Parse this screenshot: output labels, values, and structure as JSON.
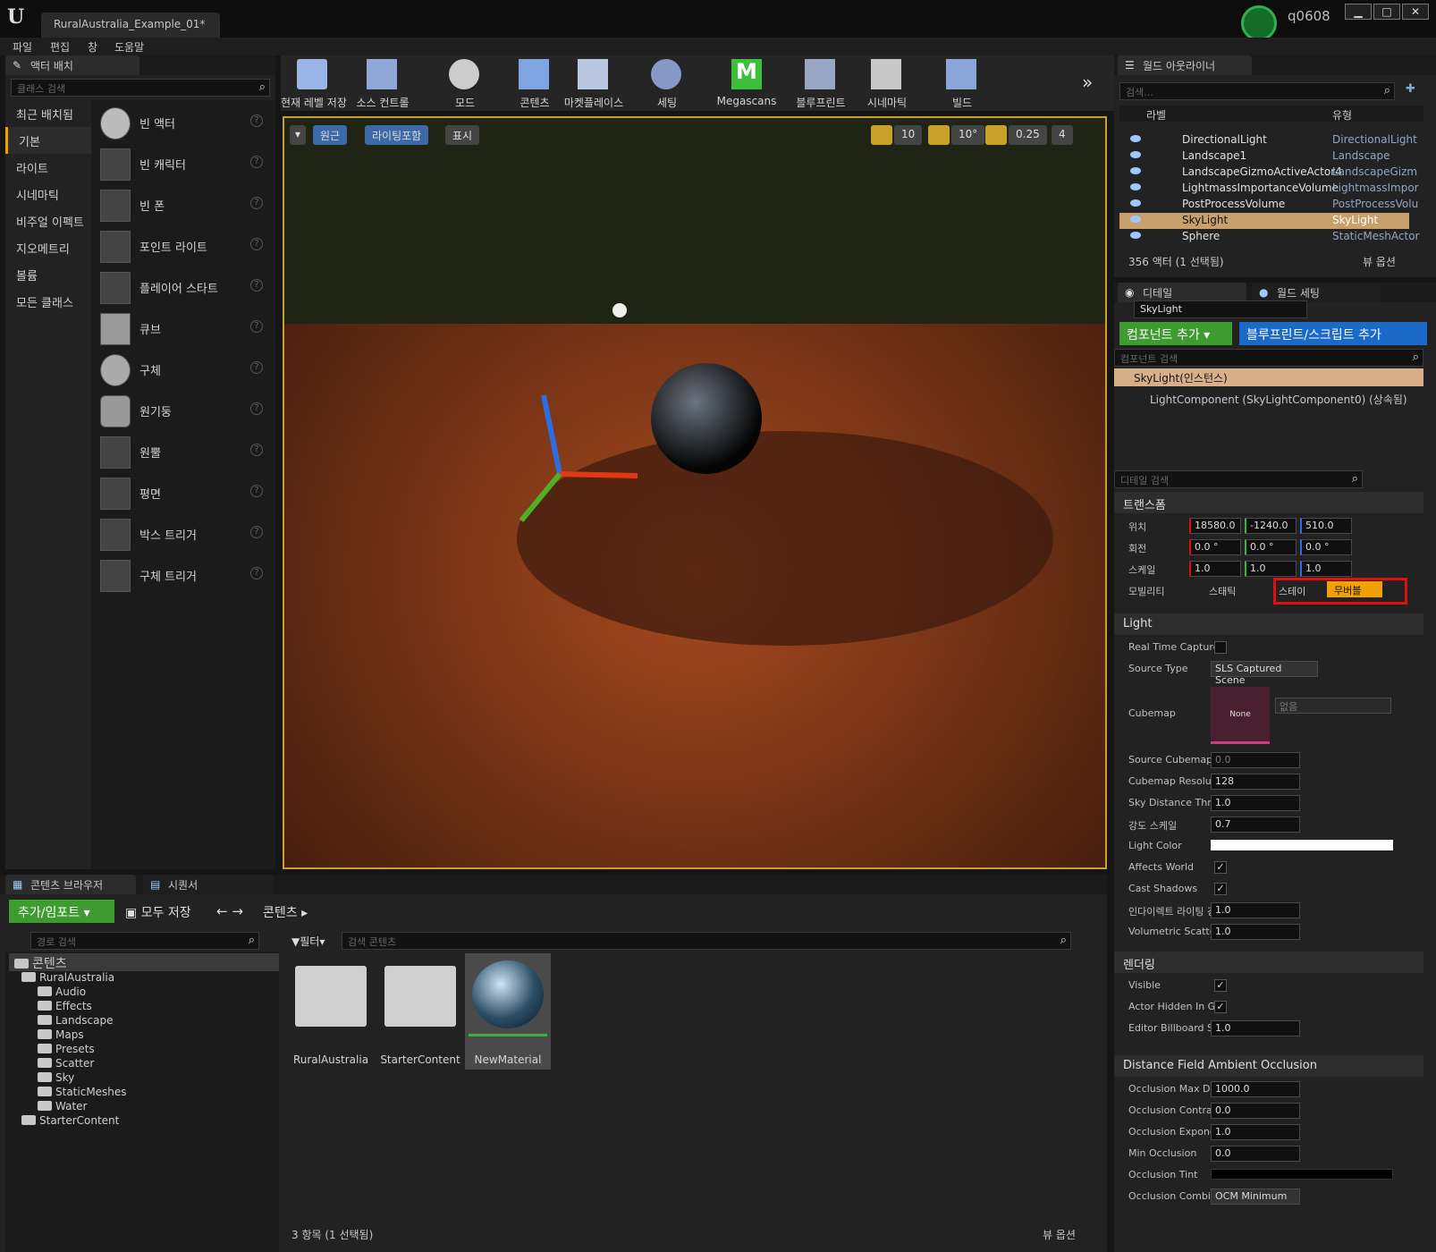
{
  "window": {
    "tab_title": "RuralAustralia_Example_01*",
    "user": "q0608",
    "minimize": "▁",
    "maximize": "□",
    "close": "✕"
  },
  "menu": [
    "파일",
    "편집",
    "창",
    "도움말"
  ],
  "place_panel": {
    "tab": "액터 배치",
    "search_placeholder": "클래스 검색",
    "categories": [
      "최근 배치됨",
      "기본",
      "라이트",
      "시네마틱",
      "비주얼 이펙트",
      "지오메트리",
      "볼륨",
      "모든 클래스"
    ],
    "items": [
      "빈 액터",
      "빈 캐릭터",
      "빈 폰",
      "포인트 라이트",
      "플레이어 스타트",
      "큐브",
      "구체",
      "원기둥",
      "원뿔",
      "평면",
      "박스 트리거",
      "구체 트리거"
    ]
  },
  "toolbar": [
    "현재 레벨 저장",
    "소스 컨트롤",
    "모드",
    "콘텐츠",
    "마켓플레이스",
    "세팅",
    "Megascans",
    "블루프린트",
    "시네마틱",
    "빌드"
  ],
  "viewport": {
    "perspective": "원근",
    "lighting": "라이팅포함",
    "show": "표시",
    "grid": "10",
    "rot": "10°",
    "scale": "0.25",
    "cam": "4"
  },
  "outliner": {
    "tab": "월드 아웃라이너",
    "search_placeholder": "검색...",
    "col_label": "라벨",
    "col_type": "유형",
    "rows": [
      {
        "label": "DirectionalLight",
        "type": "DirectionalLight"
      },
      {
        "label": "Landscape1",
        "type": "Landscape"
      },
      {
        "label": "LandscapeGizmoActiveActor4",
        "type": "LandscapeGizm"
      },
      {
        "label": "LightmassImportanceVolume",
        "type": "LightmassImpor"
      },
      {
        "label": "PostProcessVolume",
        "type": "PostProcessVolu"
      },
      {
        "label": "SkyLight",
        "type": "SkyLight"
      },
      {
        "label": "Sphere",
        "type": "StaticMeshActor"
      }
    ],
    "footer": "356 액터 (1 선택됨)",
    "view_options": "뷰 옵션"
  },
  "details": {
    "tab": "디테일",
    "tab2": "월드 세팅",
    "name": "SkyLight",
    "add_component": "컴포넌트 추가",
    "blueprint": "블루프린트/스크립트 추가",
    "comp_search": "컴포넌트 검색",
    "instance": "SkyLight(인스턴스)",
    "component": "LightComponent (SkyLightComponent0) (상속됨)",
    "detail_search": "디테일 검색",
    "transform": {
      "section": "트랜스폼",
      "location_label": "위치",
      "rotation_label": "회전",
      "scale_label": "스케일",
      "mobility_label": "모빌리티",
      "location": [
        "18580.0",
        "-1240.0",
        "510.0"
      ],
      "rotation": [
        "0.0 °",
        "0.0 °",
        "0.0 °"
      ],
      "scale": [
        "1.0",
        "1.0",
        "1.0"
      ],
      "mobility": [
        "스태틱",
        "스테이",
        "무버블"
      ]
    },
    "light": {
      "section": "Light",
      "real_time_capture": "Real Time Capture",
      "source_type_label": "Source Type",
      "source_type": "SLS Captured Scene",
      "cubemap_label": "Cubemap",
      "cubemap_none": "None",
      "cubemap_value": "없음",
      "source_cubemap_angle": "Source Cubemap A",
      "source_cubemap_angle_val": "0.0",
      "cubemap_res": "Cubemap Resolutio",
      "cubemap_res_val": "128",
      "sky_distance": "Sky Distance Thres",
      "sky_distance_val": "1.0",
      "intensity": "강도 스케일",
      "intensity_val": "0.7",
      "light_color": "Light Color",
      "affects_world": "Affects World",
      "cast_shadows": "Cast Shadows",
      "indirect": "인다이렉트 라이팅 강",
      "indirect_val": "1.0",
      "volumetric": "Volumetric Scatter",
      "volumetric_val": "1.0"
    },
    "rendering": {
      "section": "렌더링",
      "visible": "Visible",
      "hidden_game": "Actor Hidden In Gai",
      "billboard": "Editor Billboard Sca",
      "billboard_val": "1.0"
    },
    "dfao": {
      "section": "Distance Field Ambient Occlusion",
      "max_dist": "Occlusion Max Dis",
      "max_dist_val": "1000.0",
      "contrast": "Occlusion Contrast",
      "contrast_val": "0.0",
      "exponent": "Occlusion Exponen",
      "exponent_val": "1.0",
      "min_occ": "Min Occlusion",
      "min_occ_val": "0.0",
      "tint": "Occlusion Tint",
      "combine": "Occlusion Combine",
      "combine_val": "OCM Minimum"
    }
  },
  "content_browser": {
    "tab": "콘텐츠 브라우저",
    "tab2": "시퀀서",
    "add_import": "추가/임포트",
    "save_all": "모두 저장",
    "path": "콘텐츠",
    "path_search": "경로 검색",
    "filter": "필터",
    "content_search": "검색 콘텐츠",
    "tree_root": "콘텐츠",
    "tree": [
      "RuralAustralia",
      "Audio",
      "Effects",
      "Landscape",
      "Maps",
      "Presets",
      "Scatter",
      "Sky",
      "StaticMeshes",
      "Water",
      "StarterContent"
    ],
    "assets": [
      "RuralAustralia",
      "StarterContent",
      "NewMaterial"
    ],
    "footer": "3 항목 (1 선택됨)",
    "view_options": "뷰 옵션"
  },
  "colors": {
    "accent_orange": "#f0a000",
    "highlight_red": "#e01010",
    "green_button": "#3e9b2f",
    "blue_button": "#1b6ac7"
  }
}
